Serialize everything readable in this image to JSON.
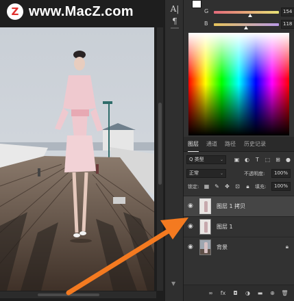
{
  "watermark": {
    "logo_letter": "Z",
    "text": "www.MacZ.com"
  },
  "toolstrip": {
    "items": [
      "A|",
      "¶"
    ]
  },
  "color_panel": {
    "sliders": [
      {
        "channel": "G",
        "value": "154"
      },
      {
        "channel": "B",
        "value": "118"
      }
    ]
  },
  "layers_panel": {
    "tabs": [
      "图层",
      "通道",
      "路径",
      "历史记录"
    ],
    "filter": {
      "label": "Q 类型"
    },
    "blend_mode": "正常",
    "opacity": {
      "label": "不透明度:",
      "value": "100%"
    },
    "lock_label": "锁定:",
    "fill": {
      "label": "填充:",
      "value": "100%"
    },
    "layers": [
      {
        "name": "图层 1 拷贝",
        "selected": true,
        "locked": false
      },
      {
        "name": "图层 1",
        "selected": false,
        "locked": false
      },
      {
        "name": "背景",
        "selected": false,
        "locked": true
      }
    ],
    "footer_icons": [
      "link-icon",
      "fx-icon",
      "mask-icon",
      "adjustment-icon",
      "group-folder-icon",
      "new-layer-icon",
      "trash-icon"
    ]
  },
  "colors": {
    "annotation_arrow": "#f47a20",
    "selected_row": "#454545",
    "panel_bg": "#323232"
  }
}
